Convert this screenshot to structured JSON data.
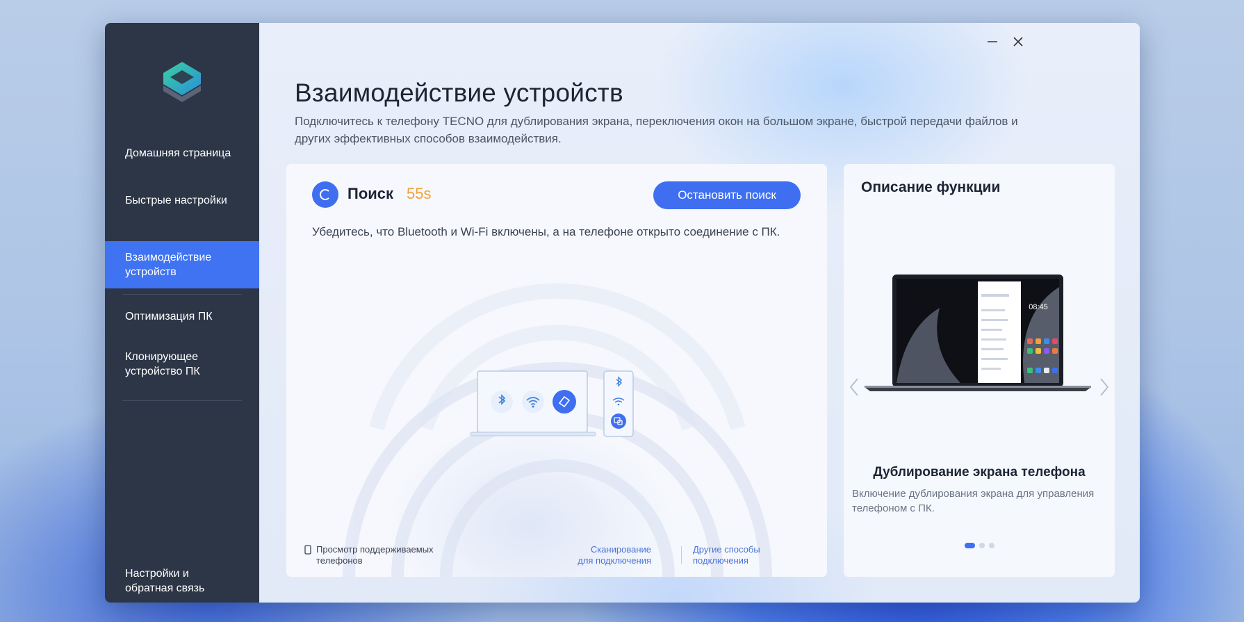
{
  "window": {
    "minimize_label": "Minimize",
    "close_label": "Close"
  },
  "sidebar": {
    "items": [
      {
        "label": "Домашняя страница"
      },
      {
        "label": "Быстрые настройки"
      },
      {
        "label": "Взаимодействие устройств",
        "active": true
      },
      {
        "label": "Оптимизация ПК"
      },
      {
        "label": "Клонирующее устройство ПК"
      }
    ],
    "footer_label": "Настройки и обратная связь"
  },
  "page": {
    "title": "Взаимодействие устройств",
    "subtitle": "Подключитесь к телефону TECNO для дублирования экрана, переключения окон на большом экране, быстрой передачи файлов и других эффективных способов взаимодействия."
  },
  "search": {
    "label": "Поиск",
    "timer": "55s",
    "stop_button": "Остановить поиск",
    "hint": "Убедитесь, что Bluetooth и Wi-Fi включены, а на телефоне открыто соединение с ПК.",
    "view_phones": "Просмотр поддерживаемых телефонов",
    "scan_link": "Сканирование для подключения",
    "other_link": "Другие способы подключения"
  },
  "function": {
    "title": "Описание функции",
    "feature_title": "Дублирование экрана телефона",
    "feature_desc": "Включение дублирования экрана для управления телефоном с ПК.",
    "phone_time": "08:45",
    "slides_count": 3,
    "active_slide": 1
  },
  "colors": {
    "accent": "#3f6ff0",
    "sidebar_bg": "#2d3647",
    "timer": "#f0a13c",
    "link": "#4a72d8"
  }
}
